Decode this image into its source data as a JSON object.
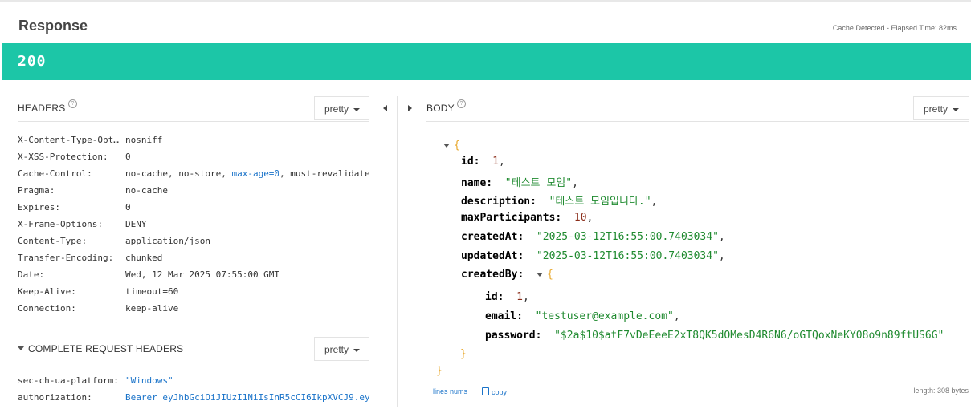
{
  "header": {
    "title": "Response",
    "cache_text": "Cache Detected - Elapsed Time: 82ms"
  },
  "status": {
    "code": "200",
    "color": "#1cc6a7"
  },
  "headers_panel": {
    "label": "HEADERS",
    "format": "pretty",
    "rows": [
      {
        "key": "X-Content-Type-Opt…",
        "value": "nosniff"
      },
      {
        "key": "X-XSS-Protection:",
        "value": "0"
      },
      {
        "key": "Cache-Control:",
        "value_pre": "no-cache, no-store, ",
        "value_hl": "max-age=0",
        "value_post": ", must-revalidate"
      },
      {
        "key": "Pragma:",
        "value": "no-cache"
      },
      {
        "key": "Expires:",
        "value": "0"
      },
      {
        "key": "X-Frame-Options:",
        "value": "DENY"
      },
      {
        "key": "Content-Type:",
        "value": "application/json"
      },
      {
        "key": "Transfer-Encoding:",
        "value": "chunked"
      },
      {
        "key": "Date:",
        "value": "Wed, 12 Mar 2025 07:55:00 GMT"
      },
      {
        "key": "Keep-Alive:",
        "value": "timeout=60"
      },
      {
        "key": "Connection:",
        "value": "keep-alive"
      }
    ]
  },
  "request_headers_panel": {
    "label": "COMPLETE REQUEST HEADERS",
    "format": "pretty",
    "rows": [
      {
        "key": "sec-ch-ua-platform:",
        "value": "\"Windows\""
      },
      {
        "key": "authorization:",
        "value": "Bearer eyJhbGciOiJIUzI1NiIsInR5cCI6IkpXVCJ9.ey"
      }
    ]
  },
  "body_panel": {
    "label": "BODY",
    "format": "pretty",
    "json": {
      "open": "{",
      "close": "}",
      "id": {
        "key": "id:",
        "value": "1",
        "comma": ","
      },
      "name": {
        "key": "name:",
        "value": "\"테스트 모임\"",
        "comma": ","
      },
      "description": {
        "key": "description:",
        "value": "\"테스트 모임입니다.\"",
        "comma": ","
      },
      "maxParticipants": {
        "key": "maxParticipants:",
        "value": "10",
        "comma": ","
      },
      "createdAt": {
        "key": "createdAt:",
        "value": "\"2025-03-12T16:55:00.7403034\"",
        "comma": ","
      },
      "updatedAt": {
        "key": "updatedAt:",
        "value": "\"2025-03-12T16:55:00.7403034\"",
        "comma": ","
      },
      "createdBy": {
        "key": "createdBy:",
        "open": "{",
        "close": "}",
        "id": {
          "key": "id:",
          "value": "1",
          "comma": ","
        },
        "email": {
          "key": "email:",
          "value": "\"testuser@example.com\"",
          "comma": ","
        },
        "password": {
          "key": "password:",
          "value": "\"$2a$10$atF7vDeEeeE2xT8QK5dOMesD4R6N6/oGTQoxNeKY08o9n89ftUS6G\""
        }
      }
    },
    "footer": {
      "line_nums": "lines nums",
      "copy": "copy",
      "length": "length: 308 bytes"
    }
  },
  "icons": [
    "help-icon",
    "dropdown-caret-icon",
    "collapse-left-icon",
    "expand-right-icon",
    "tree-toggle-icon",
    "copy-icon"
  ]
}
